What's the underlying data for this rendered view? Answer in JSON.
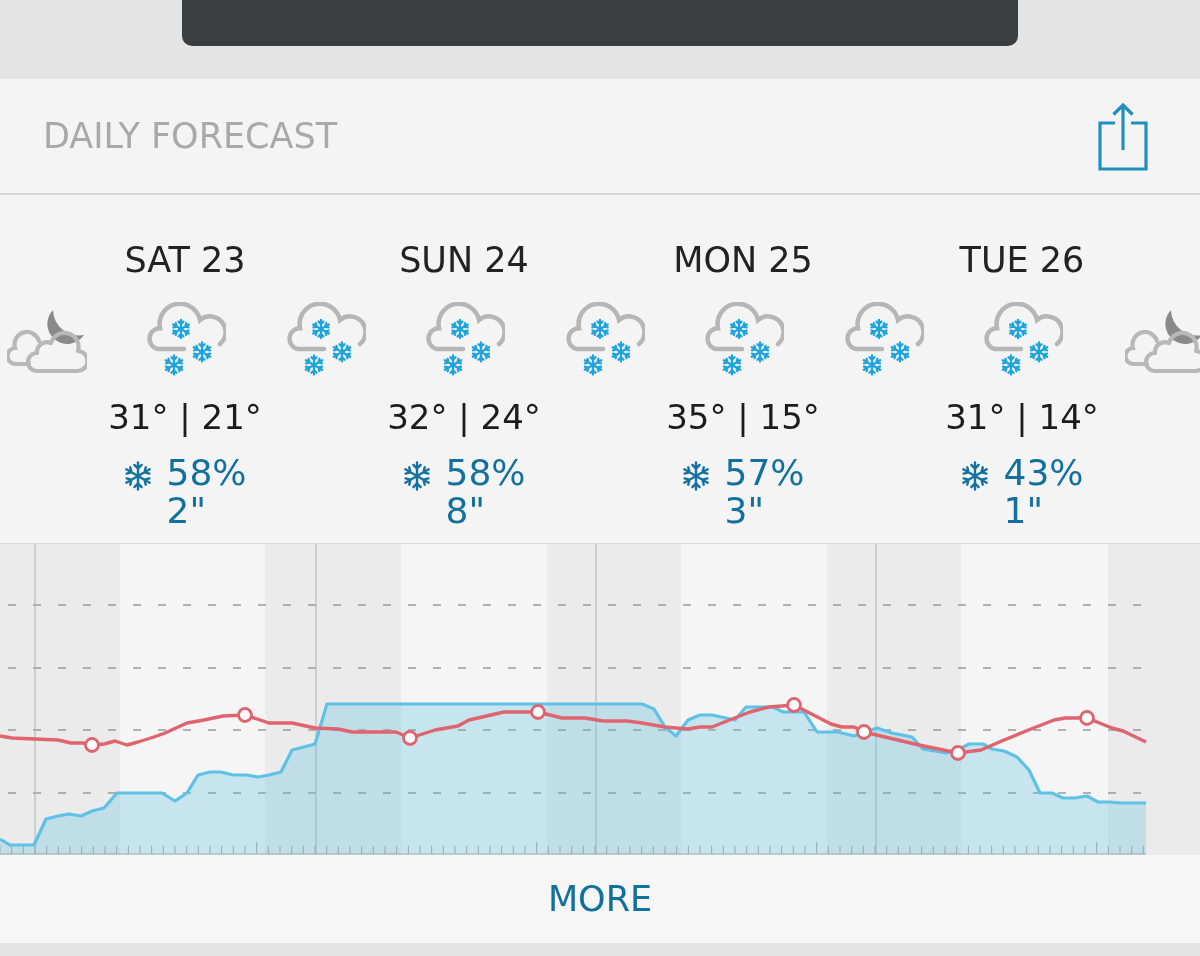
{
  "header": {
    "title": "DAILY FORECAST"
  },
  "days": [
    {
      "label": "SAT 23",
      "temperatures": "31° | 21°",
      "snow_chance": "58%",
      "snow_amount": "2\""
    },
    {
      "label": "SUN 24",
      "temperatures": "32° | 24°",
      "snow_chance": "58%",
      "snow_amount": "8\""
    },
    {
      "label": "MON 25",
      "temperatures": "35° | 15°",
      "snow_chance": "57%",
      "snow_amount": "3\""
    },
    {
      "label": "TUE 26",
      "temperatures": "31° | 14°",
      "snow_chance": "43%",
      "snow_amount": "1\""
    }
  ],
  "weather_icons": [
    {
      "kind": "cloudy-night"
    },
    {
      "kind": "snow"
    },
    {
      "kind": "snow"
    },
    {
      "kind": "snow"
    },
    {
      "kind": "snow"
    },
    {
      "kind": "snow"
    },
    {
      "kind": "snow"
    },
    {
      "kind": "snow"
    },
    {
      "kind": "cloudy-night"
    }
  ],
  "more_button": {
    "label": "MORE"
  }
}
